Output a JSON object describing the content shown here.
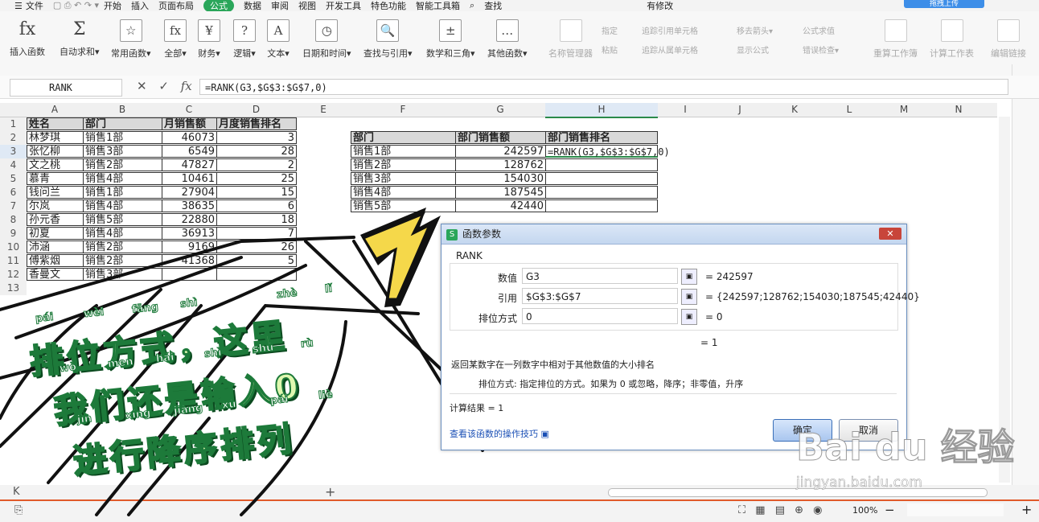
{
  "menu": {
    "tabs": [
      "文件",
      "开始",
      "插入",
      "页面布局",
      "公式",
      "数据",
      "审阅",
      "视图",
      "开发工具",
      "特色功能",
      "智能工具箱",
      "查找"
    ],
    "active_tab": "公式",
    "right_text": "有修改",
    "upload_label": "拖拽上传"
  },
  "ribbon": {
    "buttons": [
      {
        "label": "插入函数",
        "icon": "fx"
      },
      {
        "label": "自动求和▾",
        "icon": "Σ"
      },
      {
        "label": "常用函数▾",
        "icon": "☆"
      },
      {
        "label": "全部▾",
        "icon": "fx"
      },
      {
        "label": "财务▾",
        "icon": "¥"
      },
      {
        "label": "逻辑▾",
        "icon": "?"
      },
      {
        "label": "文本▾",
        "icon": "A"
      },
      {
        "label": "日期和时间▾",
        "icon": "◷"
      },
      {
        "label": "查找与引用▾",
        "icon": "🔍"
      },
      {
        "label": "数学和三角▾",
        "icon": "±"
      },
      {
        "label": "其他函数▾",
        "icon": "…"
      }
    ],
    "dim_buttons": [
      "名称管理器",
      "重算工作簿",
      "计算工作表",
      "编辑链接"
    ],
    "small": [
      "指定",
      "粘贴",
      "追踪引用单元格",
      "追踪从属单元格",
      "移去箭头▾",
      "显示公式",
      "公式求值",
      "错误检查▾"
    ]
  },
  "formula_bar": {
    "name_box": "RANK",
    "cancel_icon": "✕",
    "confirm_icon": "✓",
    "fx_icon": "fx",
    "formula": "=RANK(G3,$G$3:$G$7,0)"
  },
  "columns": [
    "A",
    "B",
    "C",
    "D",
    "E",
    "F",
    "G",
    "H",
    "I",
    "J",
    "K",
    "L",
    "M",
    "N"
  ],
  "rows": [
    "1",
    "2",
    "3",
    "4",
    "5",
    "6",
    "7",
    "8",
    "9",
    "10",
    "11",
    "12",
    "13"
  ],
  "table1": {
    "headers": [
      "姓名",
      "部门",
      "月销售额",
      "月度销售排名"
    ],
    "rows": [
      [
        "林梦琪",
        "销售1部",
        "46073",
        "3"
      ],
      [
        "张忆柳",
        "销售3部",
        "6549",
        "28"
      ],
      [
        "文之桃",
        "销售2部",
        "47827",
        "2"
      ],
      [
        "慕青",
        "销售4部",
        "10461",
        "25"
      ],
      [
        "钱问兰",
        "销售1部",
        "27904",
        "15"
      ],
      [
        "尔岚",
        "销售4部",
        "38635",
        "6"
      ],
      [
        "孙元香",
        "销售5部",
        "22880",
        "18"
      ],
      [
        "初夏",
        "销售4部",
        "36913",
        "7"
      ],
      [
        "沛涵",
        "销售2部",
        "9169",
        "26"
      ],
      [
        "傅紫烟",
        "销售2部",
        "41368",
        "5"
      ],
      [
        "香曼文",
        "销售3部",
        "",
        ""
      ]
    ]
  },
  "table2": {
    "headers": [
      "部门",
      "部门销售额",
      "部门销售排名"
    ],
    "rows": [
      [
        "销售1部",
        "242597",
        "=RANK(G3,$G$3:$G$7,0)"
      ],
      [
        "销售2部",
        "128762",
        ""
      ],
      [
        "销售3部",
        "154030",
        ""
      ],
      [
        "销售4部",
        "187545",
        ""
      ],
      [
        "销售5部",
        "42440",
        ""
      ]
    ]
  },
  "dialog": {
    "title": "函数参数",
    "func_name": "RANK",
    "args": [
      {
        "label": "数值",
        "value": "G3",
        "result": "= 242597"
      },
      {
        "label": "引用",
        "value": "$G$3:$G$7",
        "result": "= {242597;128762;154030;187545;42440}"
      },
      {
        "label": "排位方式",
        "value": "0",
        "result": "= 0"
      }
    ],
    "result_line": "= 1",
    "description": "返回某数字在一列数字中相对于其他数值的大小排名",
    "arg_help": "排位方式:  指定排位的方式。如果为 0 或忽略，降序；非零值，升序",
    "calc_result": "计算结果 =  1",
    "help_link": "查看该函数的操作技巧",
    "ok_label": "确定",
    "cancel_label": "取消",
    "close_label": "✕"
  },
  "caption": {
    "line1": "排位方式，这里",
    "line1_pinyin": [
      "pái",
      "wèi",
      "fāng",
      "shì",
      "zhè",
      "lǐ"
    ],
    "line2": "我们还是输入0",
    "line2_pinyin": [
      "wǒ",
      "men",
      "hái",
      "shì",
      "shū",
      "rù"
    ],
    "line3": "进行降序排列",
    "line3_pinyin": [
      "jìn",
      "xíng",
      "jiàng",
      "xù",
      "pái",
      "liè"
    ]
  },
  "watermark": {
    "main": "Bai du 经验",
    "sub": "jingyan.baidu.com"
  },
  "status": {
    "zoom": "100%",
    "minus": "−",
    "plus": "+"
  },
  "colors": {
    "accent_green": "#2aa65a",
    "caption_fill": "#dff8b0",
    "caption_stroke": "#1d7a3a",
    "arrow_yellow": "#f5d84a",
    "dialog_border": "#6a8fbf",
    "status_line": "#e05a2a"
  }
}
